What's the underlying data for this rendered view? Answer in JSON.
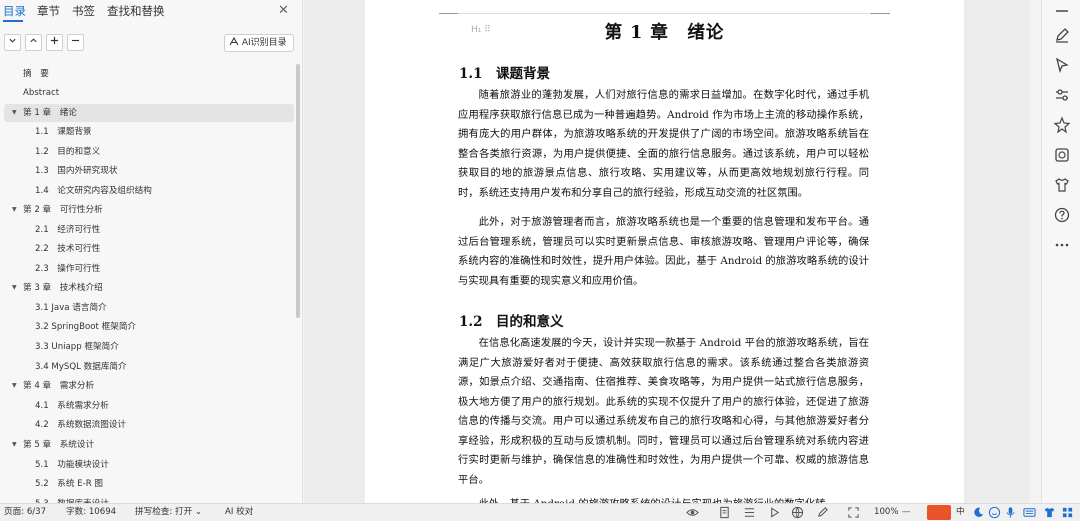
{
  "nav": {
    "tabs": [
      {
        "label": "目录"
      },
      {
        "label": "章节"
      },
      {
        "label": "书签"
      },
      {
        "label": "查找和替换"
      }
    ],
    "ai_toc_label": "AI识别目录",
    "items": [
      {
        "label": "摘　要",
        "level": 0
      },
      {
        "label": "Abstract",
        "level": 0
      },
      {
        "label": "第 1 章　绪论",
        "level": 1,
        "expanded": true,
        "selected": true
      },
      {
        "label": "1.1　课题背景",
        "level": 2
      },
      {
        "label": "1.2　目的和意义",
        "level": 2
      },
      {
        "label": "1.3　国内外研究现状",
        "level": 2
      },
      {
        "label": "1.4　论文研究内容及组织结构",
        "level": 2
      },
      {
        "label": "第 2 章　可行性分析",
        "level": 1,
        "expanded": true
      },
      {
        "label": "2.1　经济可行性",
        "level": 2
      },
      {
        "label": "2.2　技术可行性",
        "level": 2
      },
      {
        "label": "2.3　操作可行性",
        "level": 2
      },
      {
        "label": "第 3 章　技术栈介绍",
        "level": 1,
        "expanded": true
      },
      {
        "label": "3.1 Java 语言简介",
        "level": 2
      },
      {
        "label": "3.2 SpringBoot 框架简介",
        "level": 2
      },
      {
        "label": "3.3 Uniapp 框架简介",
        "level": 2
      },
      {
        "label": "3.4 MySQL 数据库简介",
        "level": 2
      },
      {
        "label": "第 4 章　需求分析",
        "level": 1,
        "expanded": true
      },
      {
        "label": "4.1　系统需求分析",
        "level": 2
      },
      {
        "label": "4.2　系统数据流图设计",
        "level": 2
      },
      {
        "label": "第 5 章　系统设计",
        "level": 1,
        "expanded": true
      },
      {
        "label": "5.1　功能模块设计",
        "level": 2
      },
      {
        "label": "5.2　系统 E-R 图",
        "level": 2
      },
      {
        "label": "5.3　数据库表设计",
        "level": 2
      }
    ]
  },
  "document": {
    "chapter_title": "第 1 章　绪论",
    "sections": [
      {
        "title": "1.1　课题背景"
      },
      {
        "title": "1.2　目的和意义"
      }
    ],
    "paragraphs": [
      "随着旅游业的蓬勃发展，人们对旅行信息的需求日益增加。在数字化时代，通过手机应用程序获取旅行信息已成为一种普遍趋势。Android 作为市场上主流的移动操作系统，拥有庞大的用户群体，为旅游攻略系统的开发提供了广阔的市场空间。旅游攻略系统旨在整合各类旅行资源，为用户提供便捷、全面的旅行信息服务。通过该系统，用户可以轻松获取目的地的旅游景点信息、旅行攻略、实用建议等，从而更高效地规划旅行行程。同时，系统还支持用户发布和分享自己的旅行经验，形成互动交流的社区氛围。",
      "此外，对于旅游管理者而言，旅游攻略系统也是一个重要的信息管理和发布平台。通过后台管理系统，管理员可以实时更新景点信息、审核旅游攻略、管理用户评论等，确保系统内容的准确性和时效性，提升用户体验。因此，基于 Android 的旅游攻略系统的设计与实现具有重要的现实意义和应用价值。",
      "在信息化高速发展的今天，设计并实现一款基于 Android 平台的旅游攻略系统，旨在满足广大旅游爱好者对于便捷、高效获取旅行信息的需求。该系统通过整合各类旅游资源，如景点介绍、交通指南、住宿推荐、美食攻略等，为用户提供一站式旅行信息服务，极大地方便了用户的旅行规划。此系统的实现不仅提升了用户的旅行体验，还促进了旅游信息的传播与交流。用户可以通过系统发布自己的旅行攻略和心得，与其他旅游爱好者分享经验，形成积极的互动与反馈机制。同时，管理员可以通过后台管理系统对系统内容进行实时更新与维护，确保信息的准确性和时效性，为用户提供一个可靠、权威的旅游信息平台。",
      "此外，基于 Android 的旅游攻略系统的设计与实现也为旅游行业的数字化转"
    ]
  },
  "status": {
    "page": "页面: 6/37",
    "words": "字数: 10694",
    "spellcheck": "拼写检查: 打开",
    "ai_proof": "AI 校对",
    "zoom": "100%",
    "ime_lang": "中"
  }
}
